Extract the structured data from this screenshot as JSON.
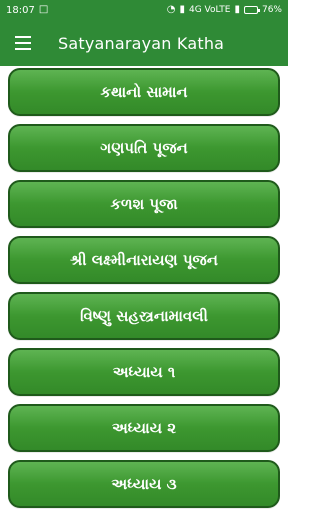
{
  "status": {
    "time": "18:07",
    "network": "4G VoLTE",
    "battery": "76%"
  },
  "app_bar": {
    "title": "Satyanarayan Katha"
  },
  "menu_items": [
    "કથાનો સામાન",
    "ગણપતિ પૂજન",
    "કળશ પૂજા",
    "શ્રી લક્ષ્મીનારાયણ પૂજન",
    "વિષ્ણુ સહસ્ત્રનામાવલી",
    "અધ્યાય ૧",
    "અધ્યાય ૨",
    "અધ્યાય ૩"
  ],
  "colors": {
    "status_bar": "#2f8a36",
    "app_bar": "#2f8a36",
    "button_fill": "#3c962f",
    "button_border": "#1f5a1b",
    "text": "#ffffff"
  },
  "icons": {
    "menu": "hamburger-menu-icon",
    "wifi": "wifi-icon",
    "signal": "signal-icon",
    "battery": "battery-icon"
  }
}
